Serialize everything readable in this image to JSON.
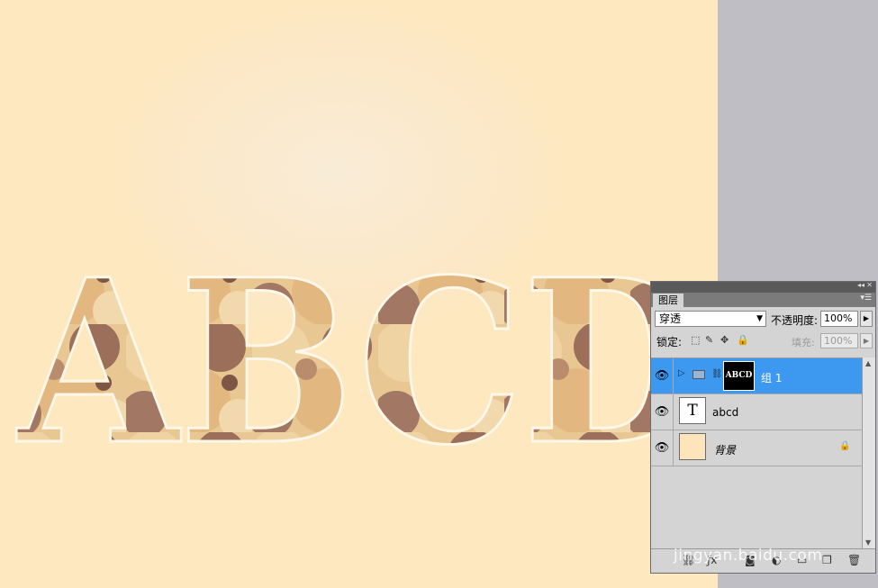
{
  "canvas": {
    "letters": "ABCD",
    "colors": {
      "background": "#fde8c0",
      "cookie_light": "#e8c490",
      "cookie_dark": "#9b6e58"
    }
  },
  "layers_panel": {
    "tab_label": "图层",
    "blend_mode": "穿透",
    "opacity_label": "不透明度:",
    "opacity_value": "100%",
    "lock_label": "锁定:",
    "fill_label": "填充:",
    "fill_value": "100%",
    "layers": [
      {
        "name": "组 1",
        "type": "group",
        "mask_thumb_text": "ABCD",
        "selected": true
      },
      {
        "name": "abcd",
        "type": "text",
        "thumb_glyph": "T"
      },
      {
        "name": "背景",
        "type": "background",
        "locked": true
      }
    ],
    "accent_color": "#3d98ef"
  },
  "watermark": "jingyan.baidu.com"
}
